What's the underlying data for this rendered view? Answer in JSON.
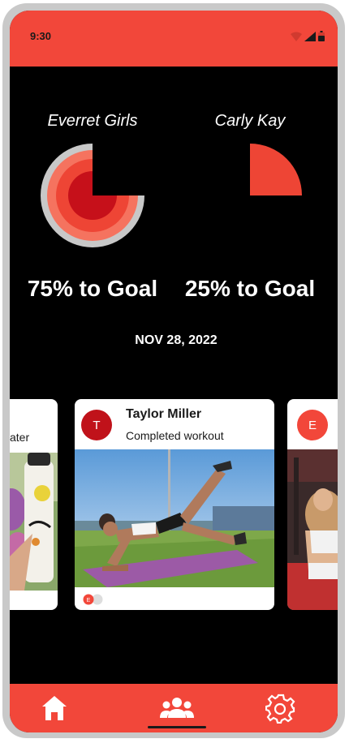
{
  "status_bar": {
    "time": "9:30",
    "icons": [
      "wifi-icon",
      "signal-icon",
      "battery-icon"
    ]
  },
  "progress": [
    {
      "name": "Everret Girls",
      "percent": 75,
      "label": "75% to Goal"
    },
    {
      "name": "Carly Kay",
      "percent": 25,
      "label": "25% to Goal"
    }
  ],
  "date": "NOV 28, 2022",
  "feed": {
    "left_card": {
      "partial_text": "ater"
    },
    "main_card": {
      "avatar_initial": "T",
      "name": "Taylor Miller",
      "status": "Completed workout",
      "reaction_initial": "E"
    },
    "right_card": {
      "avatar_initial": "E"
    }
  },
  "nav": {
    "items": [
      "home-icon",
      "group-icon",
      "settings-icon"
    ],
    "active": "group-icon"
  },
  "colors": {
    "accent": "#f2473a",
    "background": "#000000",
    "avatar_dark": "#c0121a",
    "chart_ring_1": "#c8c8c8",
    "chart_ring_2": "#f5735f",
    "chart_ring_3": "#ee4535",
    "chart_ring_4": "#c6101a"
  }
}
